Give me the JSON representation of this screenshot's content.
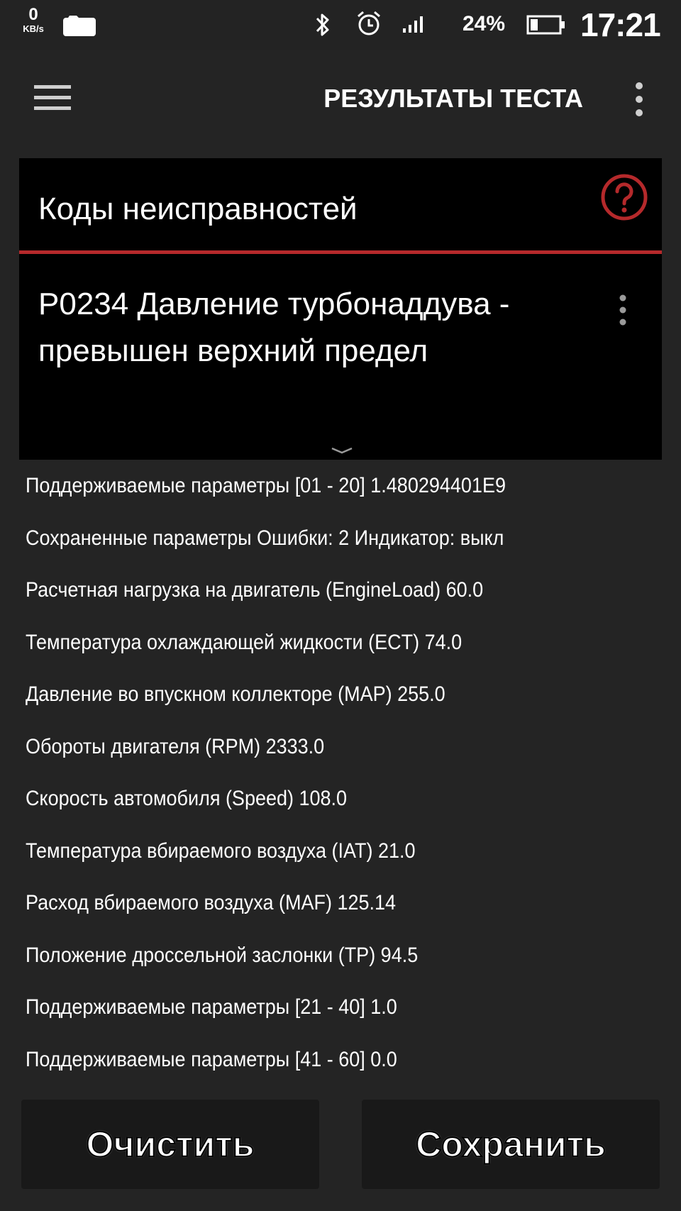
{
  "status_bar": {
    "net_speed_value": "0",
    "net_speed_unit": "KB/s",
    "battery_percent": "24%",
    "time": "17:21"
  },
  "app_bar": {
    "title": "РЕЗУЛЬТАТЫ ТЕСТА"
  },
  "card": {
    "title": "Коды неисправностей",
    "accent_color": "#b5292b"
  },
  "dtc": {
    "text": "P0234 Давление турбонаддува - превышен верхний предел"
  },
  "parameters": [
    "Поддерживаемые параметры [01 - 20] 1.480294401E9",
    "Сохраненные параметры Ошибки: 2 Индикатор: выкл",
    "Расчетная нагрузка на двигатель (EngineLoad) 60.0",
    "Температура охлаждающей жидкости (ECT) 74.0",
    "Давление во впускном коллекторе (MAP) 255.0",
    "Обороты двигателя (RPM) 2333.0",
    "Скорость автомобиля (Speed) 108.0",
    "Температура вбираемого воздуха (IAT) 21.0",
    "Расход вбираемого воздуха (MAF) 125.14",
    "Положение дроссельной заслонки (TP) 94.5",
    "Поддерживаемые параметры [21 - 40] 1.0",
    "Поддерживаемые параметры [41 - 60] 0.0"
  ],
  "buttons": {
    "clear_label": "Очистить",
    "save_label": "Сохранить"
  },
  "icons": {
    "status": [
      "photo-icon",
      "bluetooth-icon",
      "alarm-icon",
      "signal-icon",
      "battery-icon"
    ],
    "app_bar": [
      "menu-icon",
      "overflow-menu-icon"
    ],
    "card": [
      "help-icon",
      "item-menu-icon",
      "expand-chevron-icon"
    ]
  }
}
